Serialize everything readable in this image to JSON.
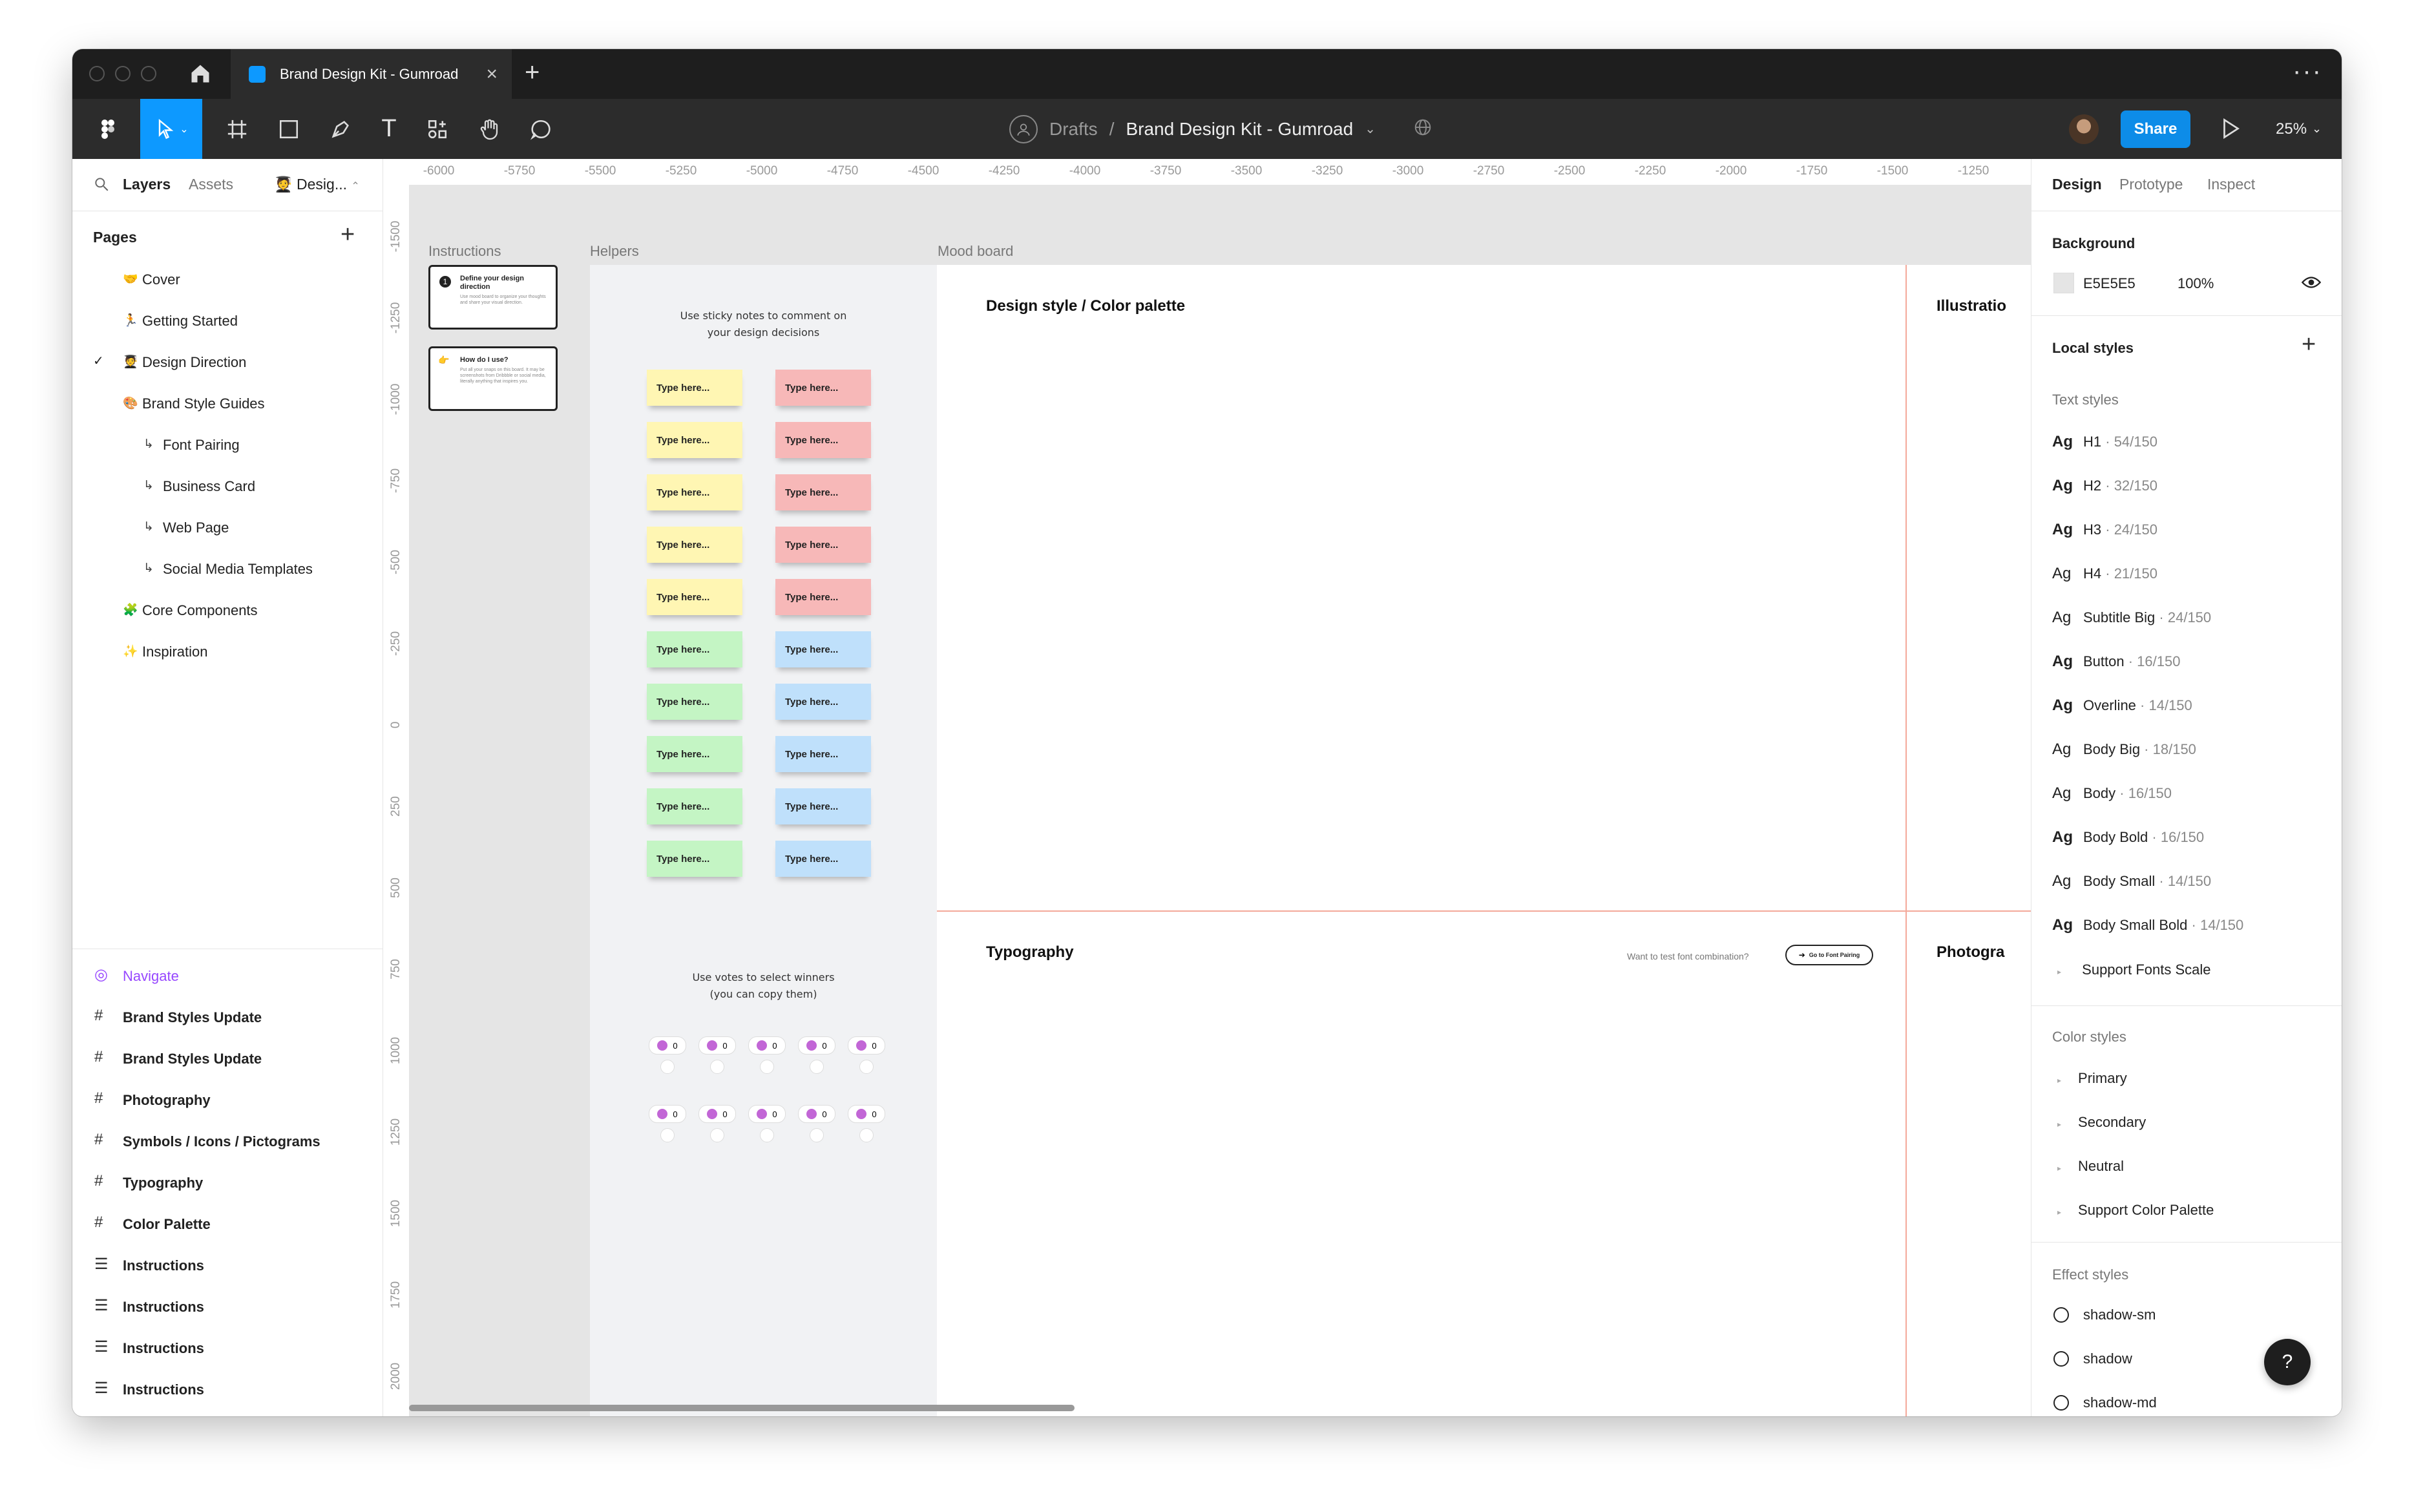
{
  "tab": {
    "title": "Brand Design Kit - Gumroad"
  },
  "toolbar": {
    "breadcrumb_parent": "Drafts",
    "breadcrumb_sep": "/",
    "file_name": "Brand Design Kit - Gumroad",
    "share_label": "Share",
    "zoom": "25%"
  },
  "left": {
    "tabs": [
      "Layers",
      "Assets"
    ],
    "page_select": "Desig...",
    "pages_title": "Pages",
    "pages": [
      {
        "icon": "🤝",
        "label": "Cover"
      },
      {
        "icon": "🏃",
        "label": "Getting Started"
      },
      {
        "icon": "🧑‍🎓",
        "label": "Design Direction"
      },
      {
        "icon": "🎨",
        "label": "Brand Style Guides"
      },
      {
        "icon": "↳",
        "label": "Font Pairing"
      },
      {
        "icon": "↳",
        "label": "Business Card"
      },
      {
        "icon": "↳",
        "label": "Web Page"
      },
      {
        "icon": "↳",
        "label": "Social Media Templates"
      },
      {
        "icon": "🧩",
        "label": "Core Components"
      },
      {
        "icon": "✨",
        "label": "Inspiration"
      }
    ],
    "layers": [
      {
        "label": "Navigate"
      },
      {
        "label": "Brand Styles Update"
      },
      {
        "label": "Brand Styles Update"
      },
      {
        "label": "Photography"
      },
      {
        "label": "Symbols / Icons / Pictograms"
      },
      {
        "label": "Typography"
      },
      {
        "label": "Color Palette"
      },
      {
        "label": "Instructions"
      },
      {
        "label": "Instructions"
      },
      {
        "label": "Instructions"
      },
      {
        "label": "Instructions"
      }
    ]
  },
  "ruler": {
    "top": [
      "-6000",
      "-5750",
      "-5500",
      "-5250",
      "-5000",
      "-4750",
      "-4500",
      "-4250",
      "-4000",
      "-3750",
      "-3500",
      "-3250",
      "-3000",
      "-2750",
      "-2500",
      "-2250",
      "-2000",
      "-1750",
      "-1500",
      "-1250"
    ],
    "left": [
      "-1500",
      "-1250",
      "-1000",
      "-750",
      "-500",
      "-250",
      "0",
      "250",
      "500",
      "750",
      "1000",
      "1250",
      "1500",
      "1750",
      "2000"
    ]
  },
  "canvas": {
    "frame_labels": {
      "instructions": "Instructions",
      "helpers": "Helpers",
      "mood_board": "Mood board"
    },
    "instr_card1": {
      "title": "Define your design direction",
      "body": "Use mood board to organize your thoughts and share your visual direction."
    },
    "instr_card2": {
      "title": "How do I use?",
      "body": "Put all your snaps on this board. It may be screenshots from Dribbble or social media, literally anything that inspires you."
    },
    "sticky_hint_1": "Use sticky notes to comment on",
    "sticky_hint_2": "your design decisions",
    "sticky_text": "Type here...",
    "vote_hint_1": "Use votes to select winners",
    "vote_hint_2": "(you can copy them)",
    "vote_count": "0",
    "design_style": "Design style / Color palette",
    "illustration": "Illustratio",
    "typography": "Typography",
    "font_prompt": "Want to test font combination?",
    "font_button": "Go to Font Pairing",
    "photography": "Photogra"
  },
  "right": {
    "tabs": [
      "Design",
      "Prototype",
      "Inspect"
    ],
    "background_title": "Background",
    "bg_hex": "E5E5E5",
    "bg_opacity": "100%",
    "local_styles": "Local styles",
    "text_styles_title": "Text styles",
    "text_styles": [
      {
        "name": "H1",
        "meta": "54/150"
      },
      {
        "name": "H2",
        "meta": "32/150"
      },
      {
        "name": "H3",
        "meta": "24/150"
      },
      {
        "name": "H4",
        "meta": "21/150"
      },
      {
        "name": "Subtitle Big",
        "meta": "24/150"
      },
      {
        "name": "Button",
        "meta": "16/150"
      },
      {
        "name": "Overline",
        "meta": "14/150"
      },
      {
        "name": "Body Big",
        "meta": "18/150"
      },
      {
        "name": "Body",
        "meta": "16/150"
      },
      {
        "name": "Body Bold",
        "meta": "16/150"
      },
      {
        "name": "Body Small",
        "meta": "14/150"
      },
      {
        "name": "Body Small Bold",
        "meta": "14/150"
      }
    ],
    "support_fonts": "Support Fonts Scale",
    "color_styles_title": "Color styles",
    "color_styles": [
      "Primary",
      "Secondary",
      "Neutral",
      "Support Color Palette"
    ],
    "effect_styles_title": "Effect styles",
    "effect_styles": [
      "shadow-sm",
      "shadow",
      "shadow-md"
    ],
    "help": "?"
  },
  "colors": {
    "accent": "#0d99ff",
    "share": "#0d8ce8",
    "yellow_note": "#fff6b3",
    "pink_note": "#f7b8b8",
    "green_note": "#c4f5c4",
    "blue_note": "#bfe0fb",
    "frame_line": "#f4a99a",
    "navigate": "#9747ff"
  }
}
